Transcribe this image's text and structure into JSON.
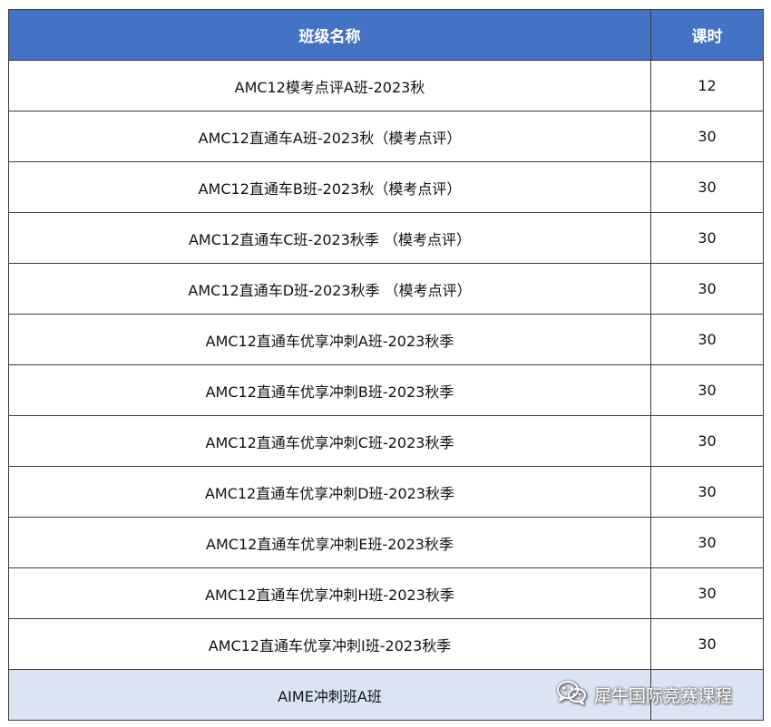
{
  "table": {
    "headers": {
      "name": "班级名称",
      "hours": "课时"
    },
    "rows": [
      {
        "name": "AMC12模考点评A班-2023秋",
        "hours": "12"
      },
      {
        "name": "AMC12直通车A班-2023秋（模考点评）",
        "hours": "30"
      },
      {
        "name": "AMC12直通车B班-2023秋（模考点评）",
        "hours": "30"
      },
      {
        "name": "AMC12直通车C班-2023秋季 （模考点评）",
        "hours": "30"
      },
      {
        "name": "AMC12直通车D班-2023秋季 （模考点评）",
        "hours": "30"
      },
      {
        "name": "AMC12直通车优享冲刺A班-2023秋季",
        "hours": "30"
      },
      {
        "name": "AMC12直通车优享冲刺B班-2023秋季",
        "hours": "30"
      },
      {
        "name": "AMC12直通车优享冲刺C班-2023秋季",
        "hours": "30"
      },
      {
        "name": "AMC12直通车优享冲刺D班-2023秋季",
        "hours": "30"
      },
      {
        "name": "AMC12直通车优享冲刺E班-2023秋季",
        "hours": "30"
      },
      {
        "name": "AMC12直通车优享冲刺H班-2023秋季",
        "hours": "30"
      },
      {
        "name": "AMC12直通车优享冲刺I班-2023秋季",
        "hours": "30"
      },
      {
        "name": "AIME冲刺班A班",
        "hours": ""
      }
    ]
  },
  "watermark": {
    "icon": "wechat-icon",
    "text": "犀牛国际竞赛课程"
  },
  "colors": {
    "header_bg": "#4472c4",
    "header_text": "#ffffff",
    "highlight_row_bg": "#dae4f3",
    "border": "#3a3a3a"
  }
}
